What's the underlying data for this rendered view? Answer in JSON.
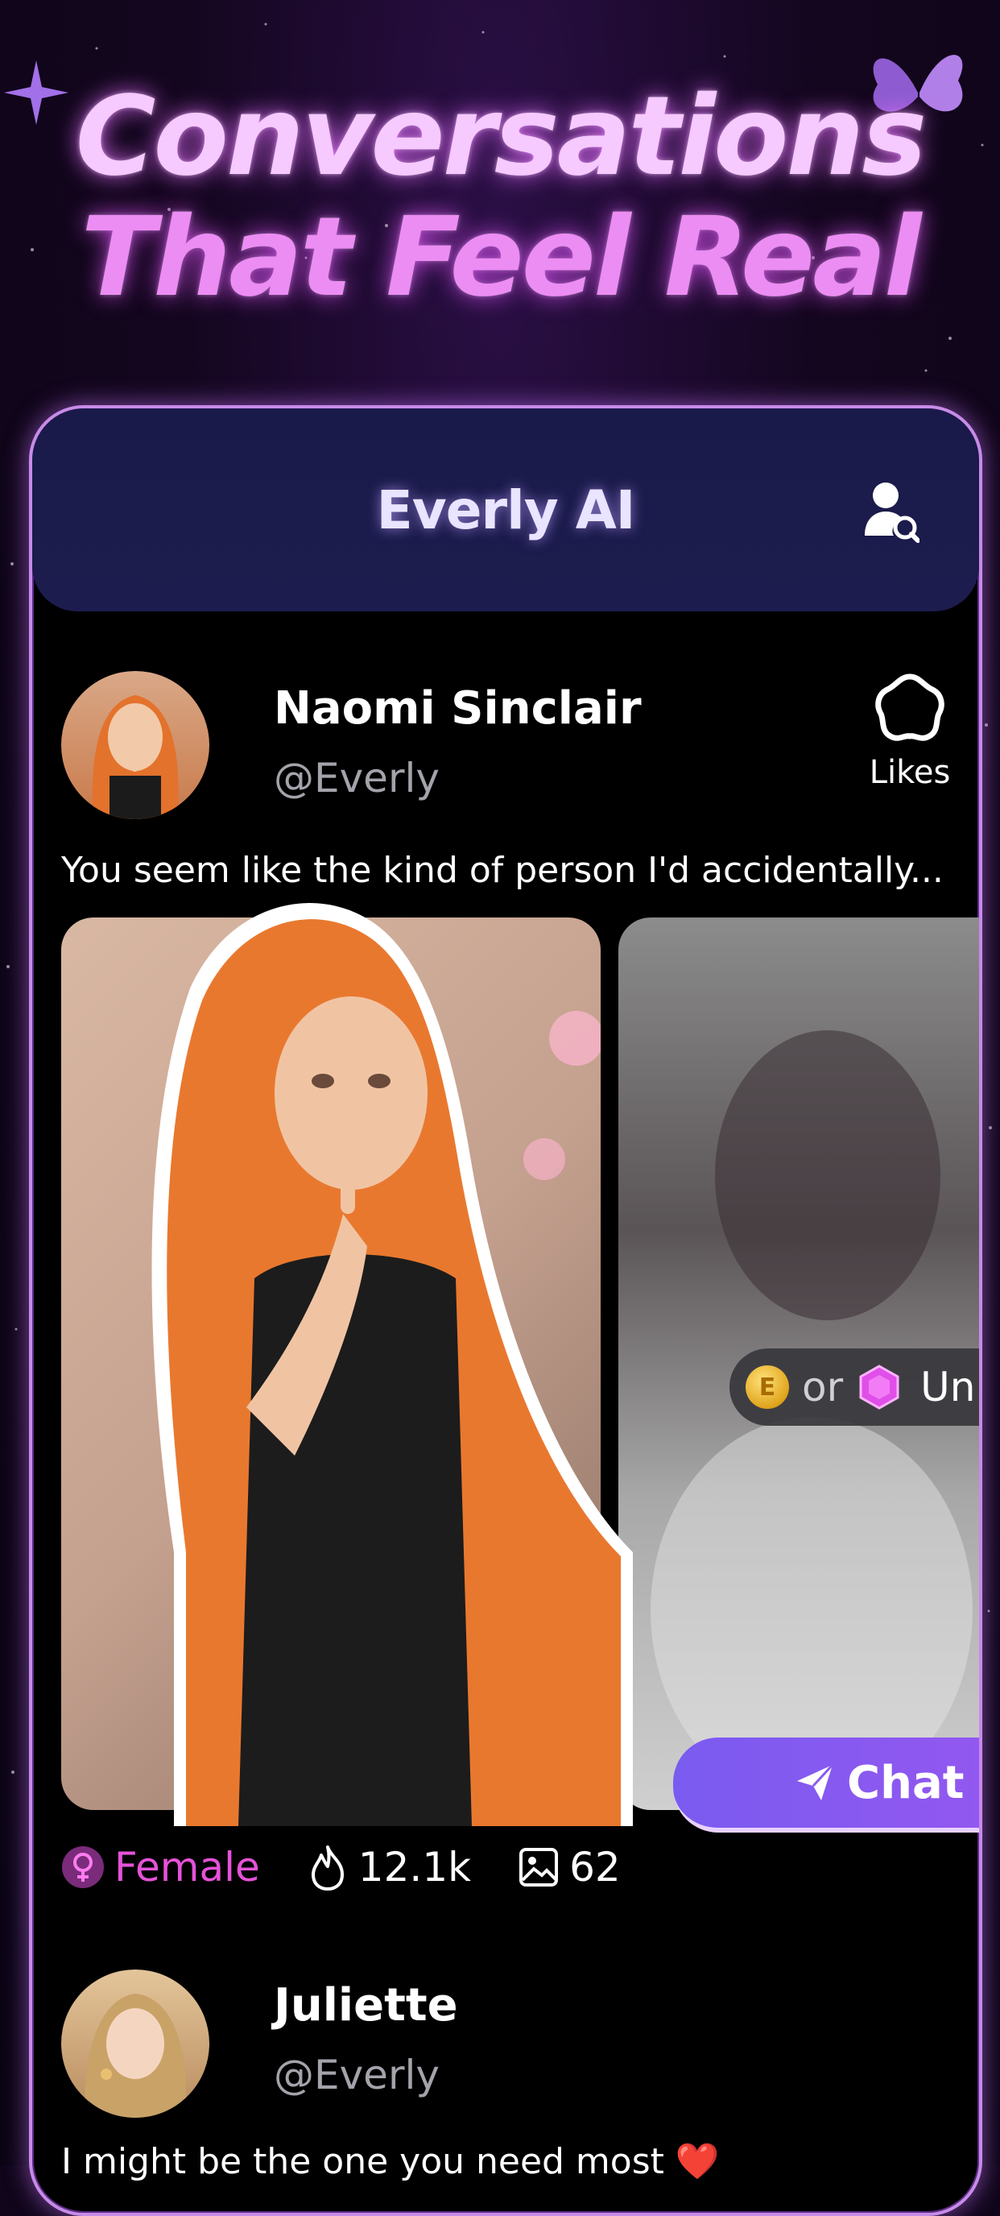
{
  "hero": {
    "line1": "Conversations",
    "line2": "That Feel Real"
  },
  "app": {
    "title": "Everly AI",
    "search_icon": "user-search-icon"
  },
  "posts": [
    {
      "name": "Naomi Sinclair",
      "handle": "@Everly",
      "likes_label": "Likes",
      "caption": "You seem like the kind of person I'd accidentally...",
      "unlock": {
        "or_label": "or",
        "label": "Unlo"
      },
      "chat_button": "Chat Wit",
      "stats": {
        "gender": "Female",
        "views": "12.1k",
        "images": "62"
      }
    },
    {
      "name": "Juliette",
      "handle": "@Everly",
      "caption": "I might be the one you need most ❤️"
    }
  ],
  "colors": {
    "accent": "#a455ef",
    "female": "#e552d8",
    "appbar": "#1c1c4e",
    "border": "#c78be8"
  }
}
